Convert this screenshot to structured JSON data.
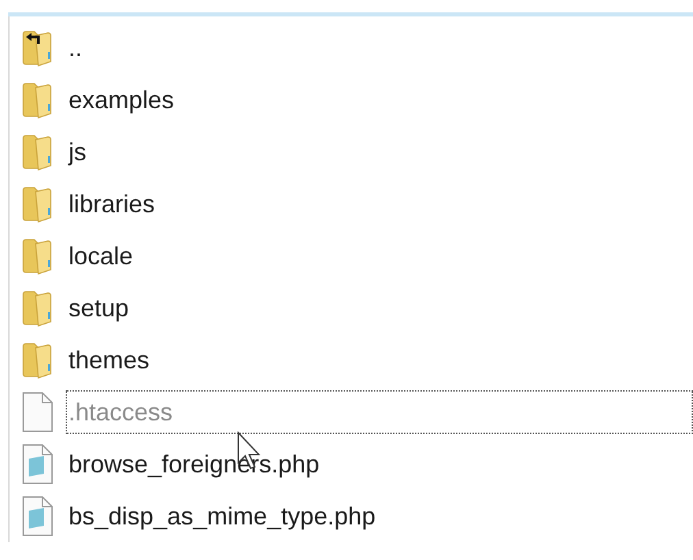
{
  "files": [
    {
      "name": "..",
      "kind": "parent",
      "focused": false,
      "hidden": false
    },
    {
      "name": "examples",
      "kind": "folder",
      "focused": false,
      "hidden": false
    },
    {
      "name": "js",
      "kind": "folder",
      "focused": false,
      "hidden": false
    },
    {
      "name": "libraries",
      "kind": "folder",
      "focused": false,
      "hidden": false
    },
    {
      "name": "locale",
      "kind": "folder",
      "focused": false,
      "hidden": false
    },
    {
      "name": "setup",
      "kind": "folder",
      "focused": false,
      "hidden": false
    },
    {
      "name": "themes",
      "kind": "folder",
      "focused": false,
      "hidden": false
    },
    {
      "name": ".htaccess",
      "kind": "file",
      "focused": true,
      "hidden": true
    },
    {
      "name": "browse_foreigners.php",
      "kind": "script",
      "focused": false,
      "hidden": false
    },
    {
      "name": "bs_disp_as_mime_type.php",
      "kind": "script",
      "focused": false,
      "hidden": false
    }
  ]
}
